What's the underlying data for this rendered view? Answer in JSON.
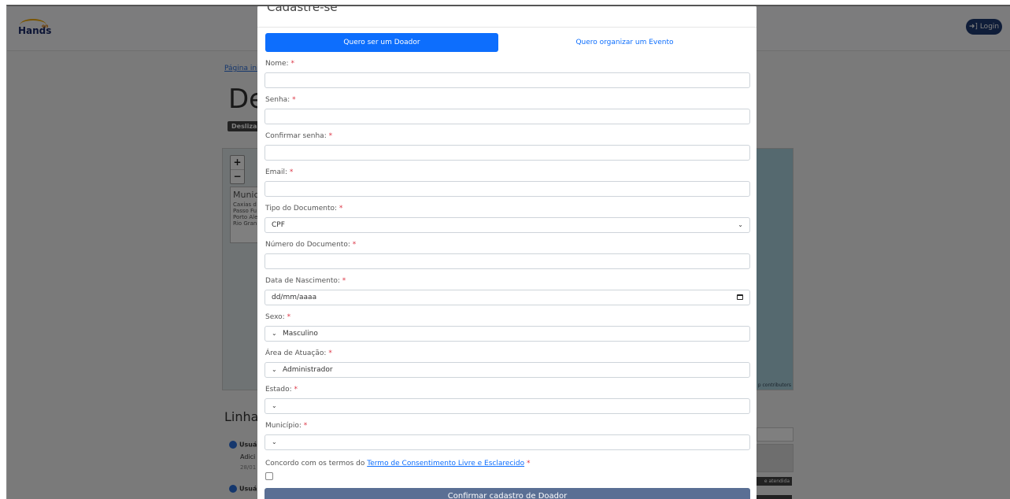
{
  "background": {
    "logo_text": "Hands",
    "logo_sup": "on",
    "login_label": "Login",
    "breadcrumb": "Página inicial",
    "page_title_fragment": "De",
    "badge_fragment": "Deslizar",
    "map_box_title": "Munic",
    "map_box_items": [
      "Caxias d",
      "Passo Fu",
      "Porto Ale",
      "Rio Gran"
    ],
    "map_attribution": "p contributors",
    "timeline_heading": "Linha d",
    "timeline_user_1": "Usuá",
    "timeline_text_1": "Adici",
    "timeline_date_1": "28/01",
    "timeline_user_2": "Usuá",
    "status_badge": "e atendida",
    "zoom_in": "+",
    "zoom_out": "−"
  },
  "modal": {
    "title": "Cadastre-se",
    "tab_donor": "Quero ser um Doador",
    "tab_event": "Quero organizar um Evento",
    "required_mark": "*",
    "fields": {
      "nome_label": "Nome:",
      "senha_label": "Senha:",
      "confirmar_label": "Confirmar senha:",
      "email_label": "Email:",
      "tipo_doc_label": "Tipo do Documento:",
      "tipo_doc_value": "CPF",
      "num_doc_label": "Número do Documento:",
      "nascimento_label": "Data de Nascimento:",
      "nascimento_placeholder": "dd/mm/aaaa",
      "sexo_label": "Sexo:",
      "sexo_value": "Masculino",
      "area_label": "Área de Atuação:",
      "area_value": "Administrador",
      "estado_label": "Estado:",
      "estado_value": "",
      "municipio_label": "Município:",
      "municipio_value": ""
    },
    "terms_prefix": "Concordo com os termos do",
    "terms_link": "Termo de Consentimento Livre e Esclarecido",
    "submit_label": "Confirmar cadastro de Doador"
  }
}
